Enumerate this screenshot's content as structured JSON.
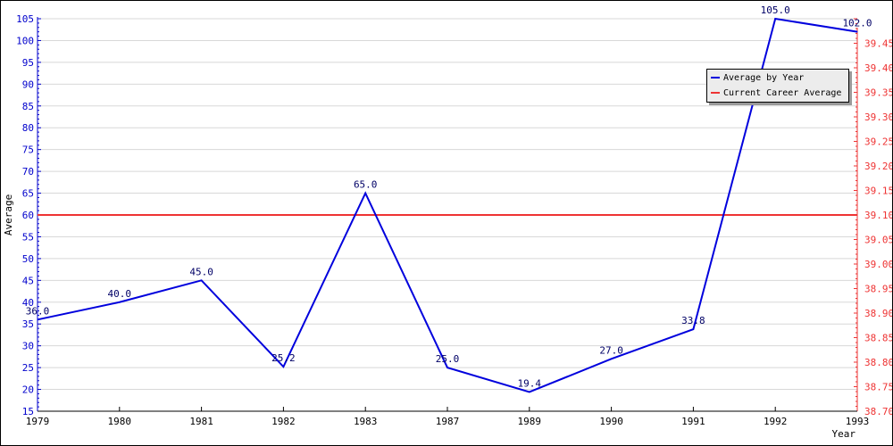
{
  "chart_data": {
    "type": "line",
    "title": "",
    "xlabel": "Year",
    "ylabel": "Average",
    "categories": [
      "1979",
      "1980",
      "1981",
      "1982",
      "1983",
      "1987",
      "1989",
      "1990",
      "1991",
      "1992",
      "1993"
    ],
    "series": [
      {
        "name": "Average by Year",
        "color": "#0000dd",
        "axis": "left",
        "values": [
          36.0,
          40.0,
          45.0,
          25.2,
          65.0,
          25.0,
          19.4,
          27.0,
          33.8,
          105.0,
          102.0
        ],
        "labels": [
          "36.0",
          "40.0",
          "45.0",
          "25.2",
          "65.0",
          "25.0",
          "19.4",
          "27.0",
          "33.8",
          "105.0",
          "102.0"
        ]
      },
      {
        "name": "Current Career Average",
        "color": "#ee3333",
        "axis": "right",
        "value": 39.1
      }
    ],
    "ylim": [
      15,
      105
    ],
    "yticks": [
      "15",
      "20",
      "25",
      "30",
      "35",
      "40",
      "45",
      "50",
      "55",
      "60",
      "65",
      "70",
      "75",
      "80",
      "85",
      "90",
      "95",
      "100",
      "105"
    ],
    "y2lim": [
      38.7,
      39.5
    ],
    "y2ticks": [
      "38.70",
      "38.75",
      "38.80",
      "38.85",
      "38.90",
      "38.95",
      "39.00",
      "39.05",
      "39.10",
      "39.15",
      "39.20",
      "39.25",
      "39.30",
      "39.35",
      "39.40",
      "39.45"
    ],
    "grid": true,
    "legend": "top-right"
  }
}
